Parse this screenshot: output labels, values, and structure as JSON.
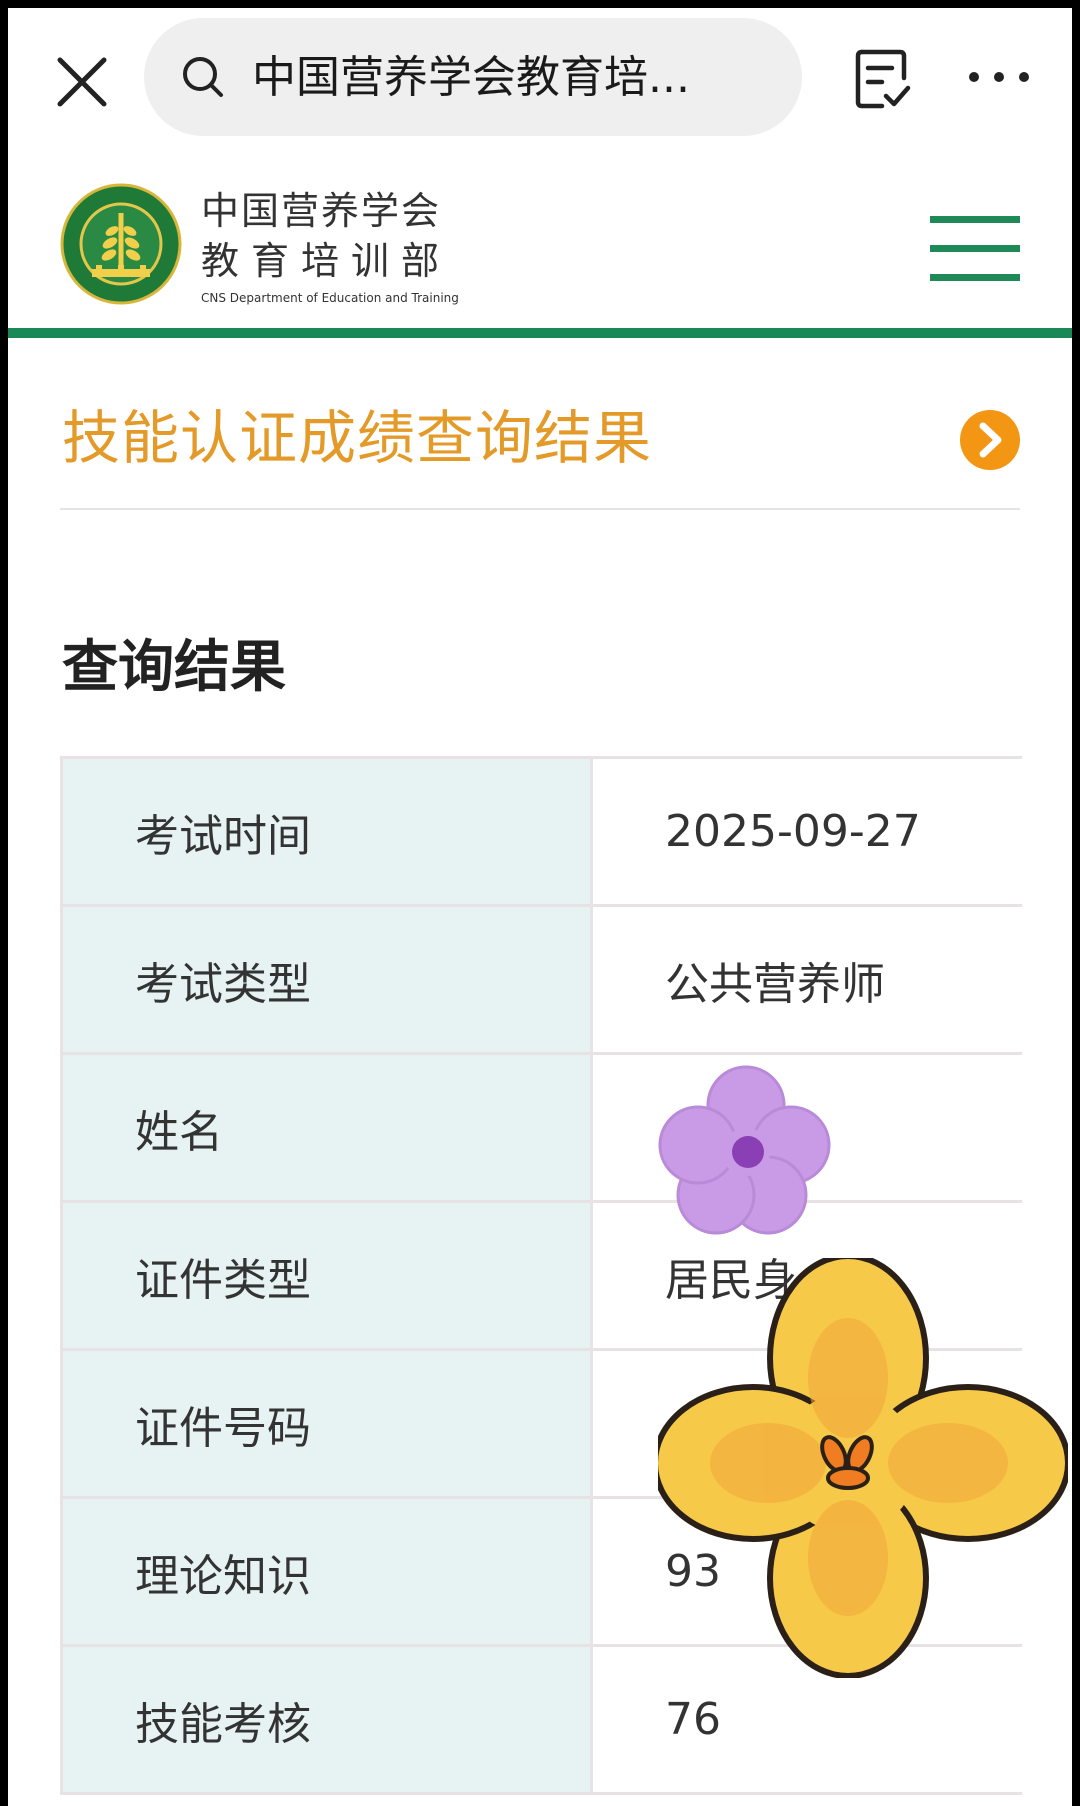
{
  "browser": {
    "search_text": "中国营养学会教育培..."
  },
  "site": {
    "org_name": "中国营养学会",
    "dept_name": "教育培训部",
    "dept_en": "CNS Department of Education and Training"
  },
  "section": {
    "title": "技能认证成绩查询结果"
  },
  "results": {
    "heading": "查询结果",
    "rows": [
      {
        "label": "考试时间",
        "value": "2025-09-27"
      },
      {
        "label": "考试类型",
        "value": "公共营养师"
      },
      {
        "label": "姓名",
        "value": ""
      },
      {
        "label": "证件类型",
        "value": "居民身"
      },
      {
        "label": "证件号码",
        "value": ""
      },
      {
        "label": "理论知识",
        "value": "93"
      },
      {
        "label": "技能考核",
        "value": "76"
      }
    ]
  },
  "colors": {
    "brand_green": "#1a8857",
    "title_orange": "#e39a28",
    "arrow_orange": "#f29613",
    "label_bg": "#e6f3f2"
  }
}
